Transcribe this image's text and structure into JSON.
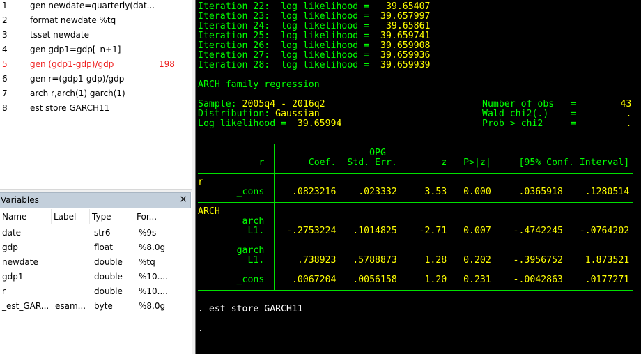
{
  "review": {
    "items": [
      {
        "num": "1",
        "cmd": "gen newdate=quarterly(dat...",
        "rc": ""
      },
      {
        "num": "2",
        "cmd": "format newdate %tq",
        "rc": ""
      },
      {
        "num": "3",
        "cmd": "tsset  newdate",
        "rc": ""
      },
      {
        "num": "4",
        "cmd": "gen gdp1=gdp[_n+1]",
        "rc": ""
      },
      {
        "num": "5",
        "cmd": "gen (gdp1-gdp)/gdp",
        "rc": "198",
        "error": true
      },
      {
        "num": "6",
        "cmd": "gen r=(gdp1-gdp)/gdp",
        "rc": ""
      },
      {
        "num": "7",
        "cmd": "arch r,arch(1) garch(1)",
        "rc": ""
      },
      {
        "num": "8",
        "cmd": "est store GARCH11",
        "rc": ""
      }
    ]
  },
  "variables": {
    "title": "Variables",
    "close_icon": "×",
    "columns": [
      "Name",
      "Label",
      "Type",
      "For..."
    ],
    "rows": [
      [
        "date",
        "",
        "str6",
        "%9s"
      ],
      [
        "gdp",
        "",
        "float",
        "%8.0g"
      ],
      [
        "newdate",
        "",
        "double",
        "%tq"
      ],
      [
        "gdp1",
        "",
        "double",
        "%10...."
      ],
      [
        "r",
        "",
        "double",
        "%10...."
      ],
      [
        "_est_GAR...",
        "esam...",
        "byte",
        "%8.0g"
      ]
    ]
  },
  "console": {
    "iterations": [
      {
        "label": "Iteration 22:  log likelihood = ",
        "value": "  39.65407"
      },
      {
        "label": "Iteration 23:  log likelihood = ",
        "value": " 39.657997"
      },
      {
        "label": "Iteration 24:  log likelihood = ",
        "value": "  39.65861"
      },
      {
        "label": "Iteration 25:  log likelihood = ",
        "value": " 39.659741"
      },
      {
        "label": "Iteration 26:  log likelihood = ",
        "value": " 39.659908"
      },
      {
        "label": "Iteration 27:  log likelihood = ",
        "value": " 39.659936"
      },
      {
        "label": "Iteration 28:  log likelihood = ",
        "value": " 39.659939"
      }
    ],
    "title": "ARCH family regression",
    "summary_left": [
      {
        "label": "Sample: ",
        "value": "2005q4 - 2016q2"
      },
      {
        "label": "Distribution: ",
        "value": "Gaussian"
      },
      {
        "label": "Log likelihood =  ",
        "value": "39.65994"
      }
    ],
    "summary_right": [
      {
        "label": "Number of obs",
        "value": "43"
      },
      {
        "label": "Wald chi2(.)",
        "value": "."
      },
      {
        "label": "Prob > chi2",
        "value": "."
      }
    ],
    "table": {
      "depvar": "r",
      "opg": "OPG",
      "headers": [
        "Coef.",
        "Std. Err.",
        "z",
        "P>|z|",
        "[95% Conf. Interval]"
      ],
      "eq_r": "r",
      "eq_arch": "ARCH",
      "rows": [
        {
          "label": "_cons",
          "vals": [
            ".0823216",
            ".023332",
            "3.53",
            "0.000",
            ".0365918",
            ".1280514"
          ]
        },
        {
          "label": "arch"
        },
        {
          "label": "L1.",
          "vals": [
            "-.2753224",
            ".1014825",
            "-2.71",
            "0.007",
            "-.4742245",
            "-.0764202"
          ]
        },
        {
          "label": "garch"
        },
        {
          "label": "L1.",
          "vals": [
            ".738923",
            ".5788873",
            "1.28",
            "0.202",
            "-.3956752",
            "1.873521"
          ]
        },
        {
          "label": "_cons",
          "vals": [
            ".0067204",
            ".0056158",
            "1.20",
            "0.231",
            "-.0042863",
            ".0177271"
          ]
        }
      ]
    },
    "command": ". est store GARCH11",
    "prompt": "."
  }
}
